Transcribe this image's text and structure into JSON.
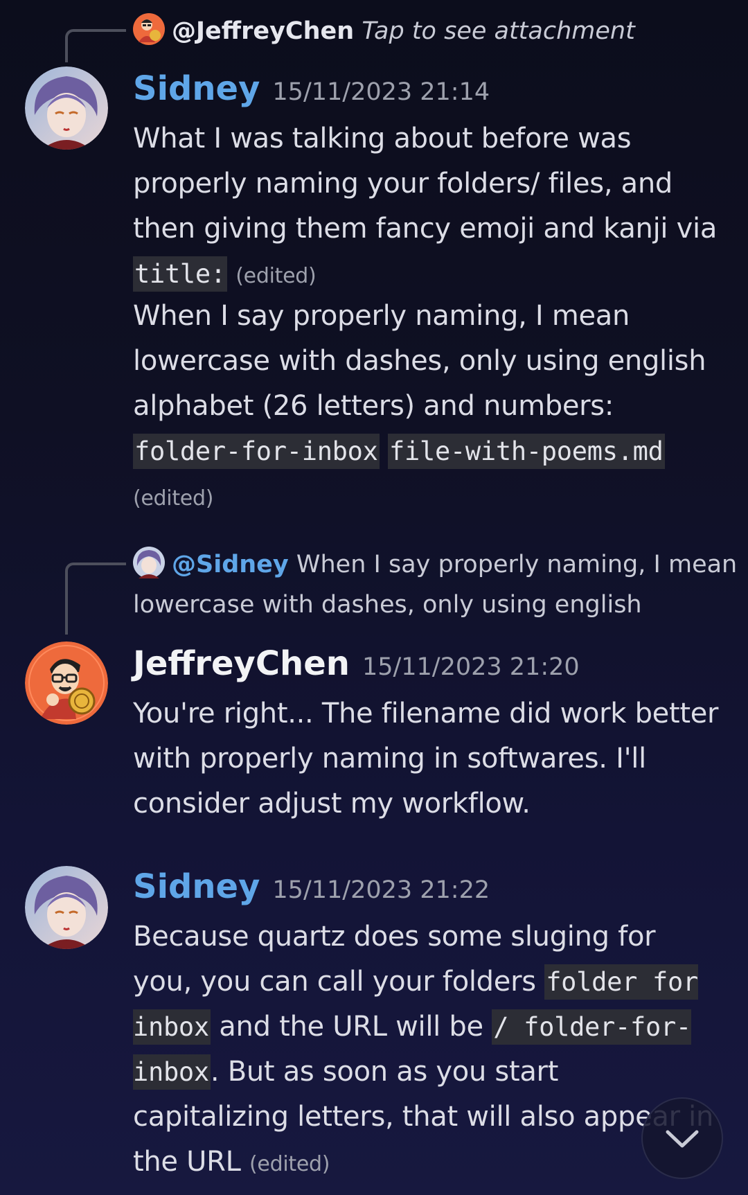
{
  "messages": [
    {
      "reply": {
        "mention": "@JeffreyChen",
        "text": "Tap to see attachment"
      },
      "author": "Sidney",
      "timestamp": "15/11/2023 21:14",
      "paragraph1": {
        "text": "What I was talking about before was properly naming your folders/ files, and then giving them fancy emoji and kanji via ",
        "code": "title:",
        "edited": "(edited)"
      },
      "paragraph2": {
        "text": "When I say properly naming, I mean lowercase with dashes, only using english alphabet (26 letters) and numbers: ",
        "code1": "folder-for-inbox",
        "code2": "file-with-poems.md",
        "edited": "(edited)"
      }
    },
    {
      "reply": {
        "mention": "@Sidney",
        "text": "When I say properly naming, I mean",
        "text2": "lowercase with dashes, only using english"
      },
      "author": "JeffreyChen",
      "timestamp": "15/11/2023 21:20",
      "text": "You're right... The filename did work better with properly naming in softwares. I'll consider adjust my workflow."
    },
    {
      "author": "Sidney",
      "timestamp": "15/11/2023 21:22",
      "part1": "Because quartz does some sluging for you, you can call your folders ",
      "code1": "folder for inbox",
      "part2": " and the URL will be ",
      "code2": "/ folder-for-inbox",
      "part3": ". But as soon as you start capitalizing letters, that will also appear in the URL ",
      "edited": "(edited)"
    }
  ],
  "colors": {
    "sidney_name": "#5fa6e8",
    "jeffrey_name": "#f2f3f5",
    "code_bg": "#2c2d35"
  },
  "icons": {
    "scroll_down": "chevron-down-icon"
  }
}
